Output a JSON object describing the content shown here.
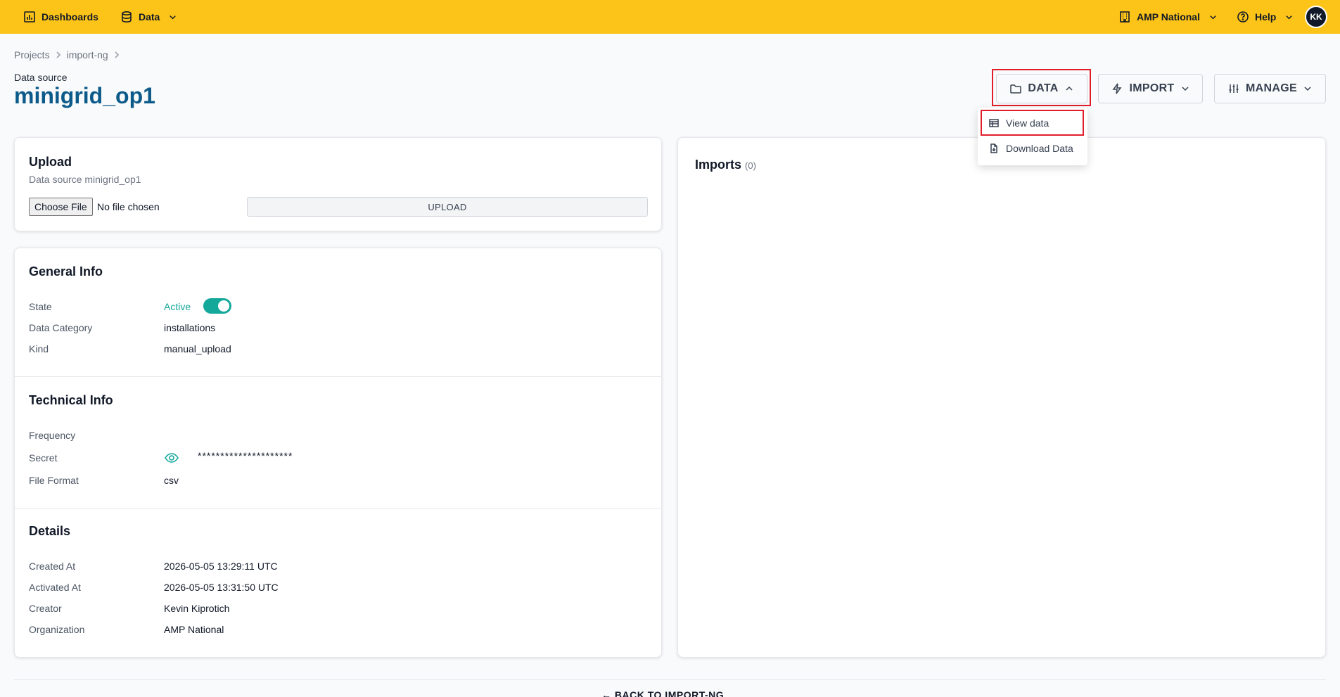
{
  "topbar": {
    "dashboards_label": "Dashboards",
    "data_label": "Data",
    "org_label": "AMP National",
    "help_label": "Help",
    "avatar_initials": "KK"
  },
  "breadcrumb": [
    "Projects",
    "import-ng"
  ],
  "header": {
    "subtitle": "Data source",
    "title": "minigrid_op1"
  },
  "actions": {
    "data_label": "DATA",
    "import_label": "IMPORT",
    "manage_label": "MANAGE"
  },
  "data_menu": {
    "items": [
      {
        "label": "View data",
        "icon": "table-icon"
      },
      {
        "label": "Download Data",
        "icon": "file-download-icon"
      }
    ]
  },
  "upload": {
    "title": "Upload",
    "subtitle": "Data source minigrid_op1",
    "choose_file_label": "Choose File",
    "no_file_label": "No file chosen",
    "upload_button_label": "UPLOAD"
  },
  "general_info": {
    "title": "General Info",
    "state_label": "State",
    "state_value": "Active",
    "category_label": "Data Category",
    "category_value": "installations",
    "kind_label": "Kind",
    "kind_value": "manual_upload"
  },
  "technical_info": {
    "title": "Technical Info",
    "frequency_label": "Frequency",
    "secret_label": "Secret",
    "secret_value": "*********************",
    "format_label": "File Format",
    "format_value": "csv"
  },
  "details": {
    "title": "Details",
    "created_label": "Created At",
    "created_value": "2026-05-05 13:29:11 UTC",
    "activated_label": "Activated At",
    "activated_value": "2026-05-05 13:31:50 UTC",
    "creator_label": "Creator",
    "creator_value": "Kevin Kiprotich",
    "org_label": "Organization",
    "org_value": "AMP National"
  },
  "imports": {
    "title": "Imports",
    "count": "(0)"
  },
  "footer": {
    "back_label": "← BACK TO IMPORT-NG"
  },
  "colors": {
    "topbar": "#fcc419",
    "title": "#0c5a8a",
    "accent": "#14a89a",
    "highlight": "#e11d2a"
  }
}
